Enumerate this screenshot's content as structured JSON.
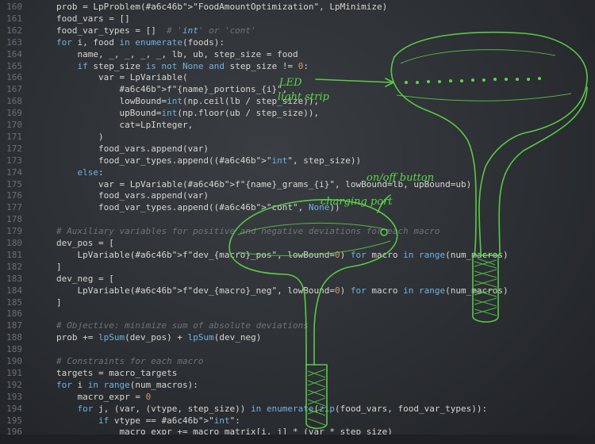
{
  "editor": {
    "line_numbers": [
      "160",
      "161",
      "162",
      "163",
      "164",
      "165",
      "166",
      "167",
      "168",
      "169",
      "170",
      "171",
      "172",
      "173",
      "174",
      "175",
      "176",
      "177",
      "178",
      "179",
      "180",
      "181",
      "182",
      "183",
      "184",
      "185",
      "186",
      "187",
      "188",
      "189",
      "190",
      "191",
      "192",
      "193",
      "194",
      "195",
      "196"
    ],
    "code_lines": [
      "prob = LpProblem(\"FoodAmountOptimization\", LpMinimize)",
      "food_vars = []",
      "food_var_types = []  # 'int' or 'cont'",
      "for i, food in enumerate(foods):",
      "    name, _, _, _, _, lb, ub, step_size = food",
      "    if step_size is not None and step_size != 0:",
      "        var = LpVariable(",
      "            f\"{name}_portions_{i}\",",
      "            lowBound=int(np.ceil(lb / step_size)),",
      "            upBound=int(np.floor(ub / step_size)),",
      "            cat=LpInteger,",
      "        )",
      "        food_vars.append(var)",
      "        food_var_types.append((\"int\", step_size))",
      "    else:",
      "        var = LpVariable(f\"{name}_grams_{i}\", lowBound=lb, upBound=ub)",
      "        food_vars.append(var)",
      "        food_var_types.append((\"cont\", None))",
      "",
      "# Auxiliary variables for positive and negative deviations for each macro",
      "dev_pos = [",
      "    LpVariable(f\"dev_{macro}_pos\", lowBound=0) for macro in range(num_macros)",
      "]",
      "dev_neg = [",
      "    LpVariable(f\"dev_{macro}_neg\", lowBound=0) for macro in range(num_macros)",
      "]",
      "",
      "# Objective: minimize sum of absolute deviations",
      "prob += lpSum(dev_pos) + lpSum(dev_neg)",
      "",
      "# Constraints for each macro",
      "targets = macro_targets",
      "for i in range(num_macros):",
      "    macro_expr = 0",
      "    for j, (var, (vtype, step_size)) in enumerate(zip(food_vars, food_var_types)):",
      "        if vtype == \"int\":",
      "            macro_expr += macro_matrix[i, j] * (var * step_size)"
    ]
  },
  "sketch": {
    "labels": {
      "led": "LED",
      "light_strip": "light strip",
      "on_off_button": "on/off button",
      "charging_port": "charging port"
    },
    "color": "#5cd64a"
  },
  "colors": {
    "keyword": "#6fb3e0",
    "string": "#a6c46b",
    "comment": "#6f747b",
    "number": "#d49a6a",
    "text": "#d7d7d2"
  }
}
